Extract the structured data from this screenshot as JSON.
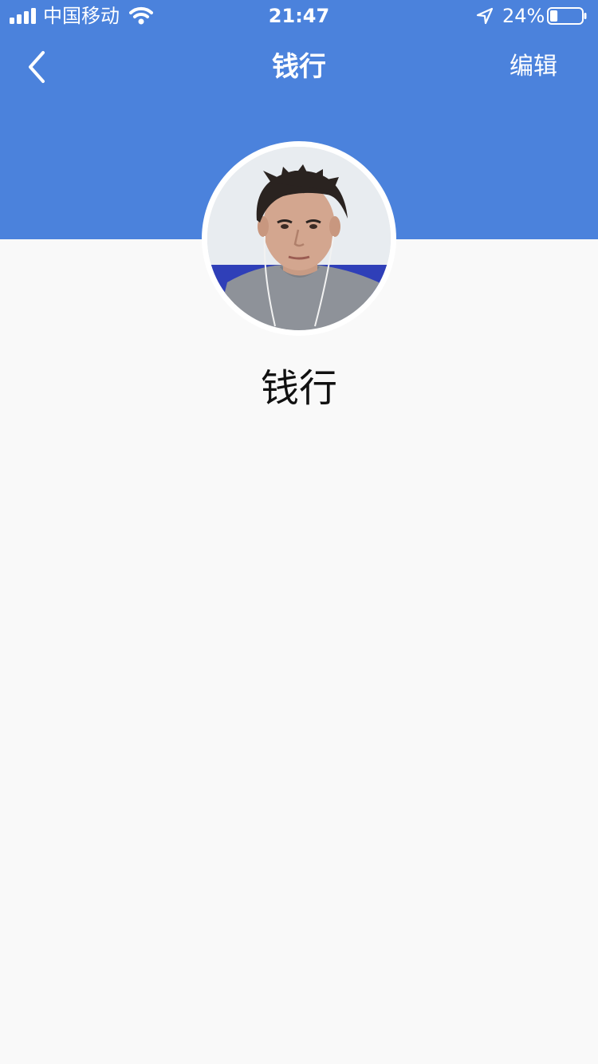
{
  "status_bar": {
    "carrier": "中国移动",
    "time": "21:47",
    "battery_percent": "24%",
    "battery_level": 0.24,
    "icons": [
      "signal-icon",
      "wifi-icon",
      "location-arrow-icon",
      "battery-icon"
    ]
  },
  "nav": {
    "title": "钱行",
    "edit_label": "编辑",
    "back_icon": "chevron-left-icon"
  },
  "profile": {
    "name": "钱行",
    "avatar": "user-photo"
  },
  "colors": {
    "header": "#4b82dc",
    "background": "#f9f9f9",
    "text": "#111111",
    "header_text": "#ffffff"
  }
}
